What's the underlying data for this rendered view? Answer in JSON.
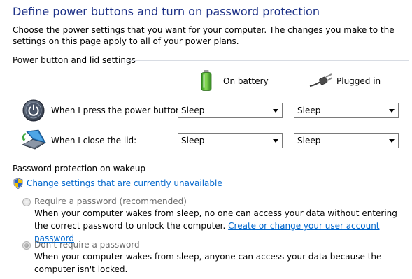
{
  "page": {
    "title": "Define power buttons and turn on password protection",
    "intro": "Choose the power settings that you want for your computer. The changes you make to the settings on this page apply to all of your power plans."
  },
  "power_section": {
    "header": "Power button and lid settings",
    "columns": {
      "battery": "On battery",
      "plugged": "Plugged in"
    },
    "rows": [
      {
        "label": "When I press the power button:",
        "battery_value": "Sleep",
        "plugged_value": "Sleep"
      },
      {
        "label": "When I close the lid:",
        "battery_value": "Sleep",
        "plugged_value": "Sleep"
      }
    ]
  },
  "password_section": {
    "header": "Password protection on wakeup",
    "change_link": "Change settings that are currently unavailable",
    "options": [
      {
        "label": "Require a password (recommended)",
        "selected": false,
        "desc_before": "When your computer wakes from sleep, no one can access your data without entering the correct password to unlock the computer.",
        "desc_link": "Create or change your user account password"
      },
      {
        "label": "Don't require a password",
        "selected": true,
        "desc": "When your computer wakes from sleep, anyone can access your data because the computer isn't locked."
      }
    ]
  },
  "colors": {
    "title": "#1e3287",
    "link": "#0066cc",
    "disabled_text": "#6d6d6d"
  }
}
